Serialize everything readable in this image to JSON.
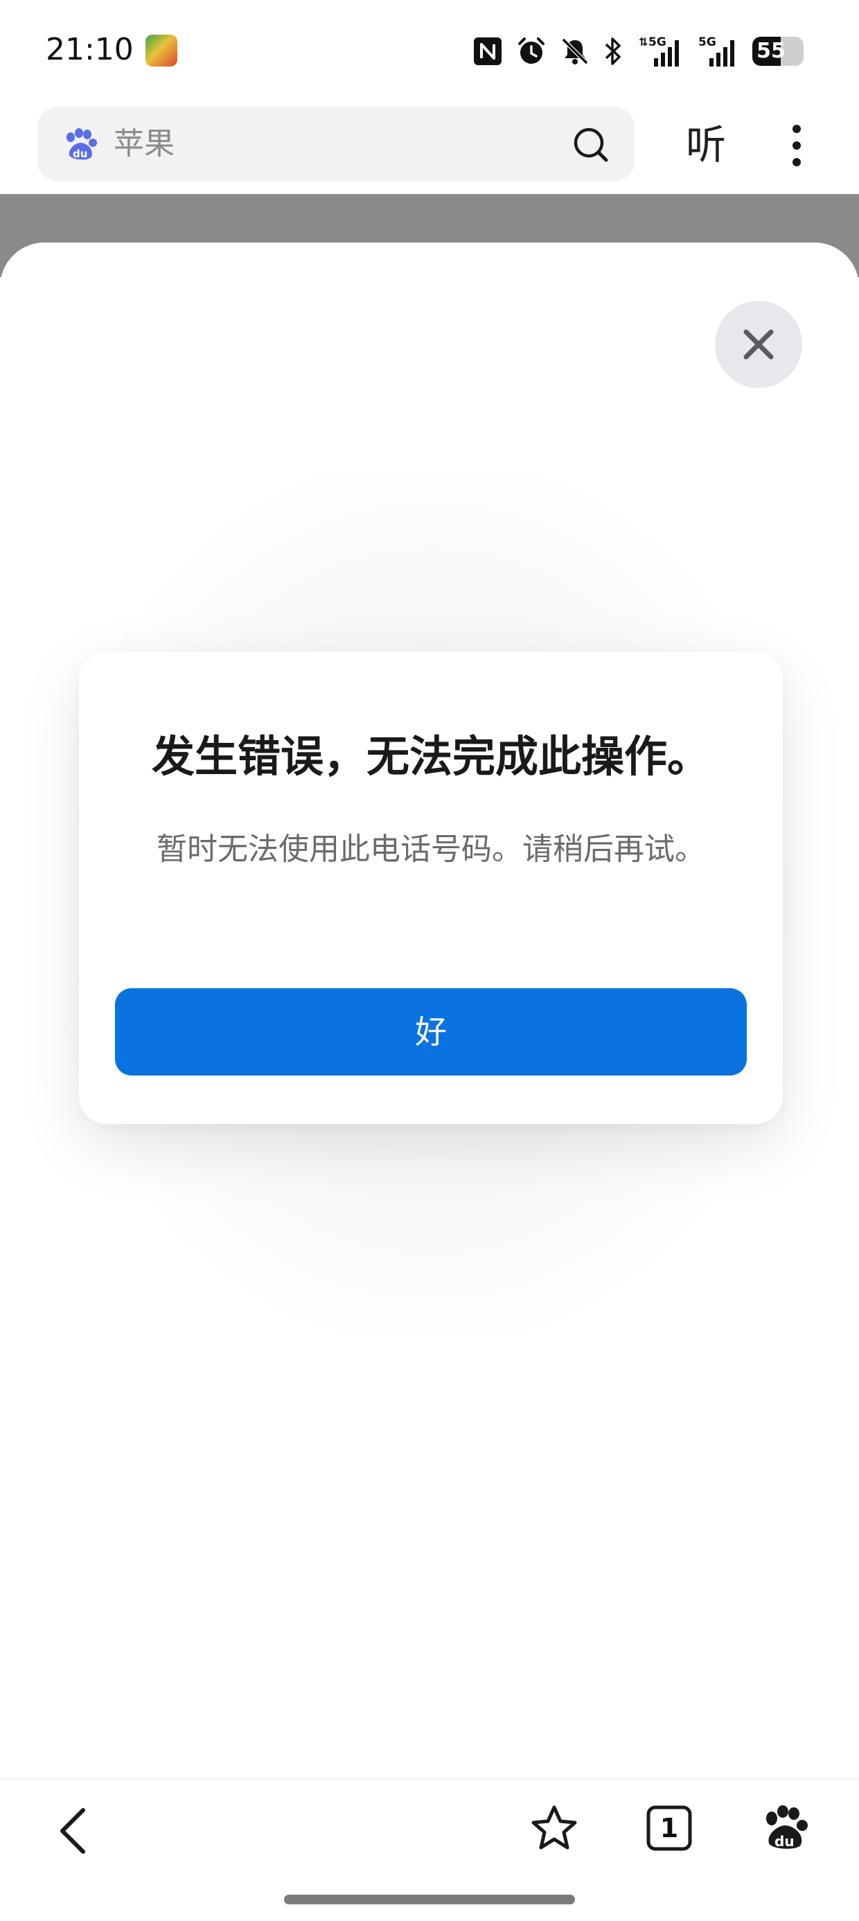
{
  "status_bar": {
    "time": "21:10",
    "battery": "55",
    "battery_fraction": 0.55,
    "signal_1": "5G",
    "signal_2": "5G"
  },
  "search": {
    "query": "苹果"
  },
  "header": {
    "listen_label": "听"
  },
  "dialog": {
    "title": "发生错误，无法完成此操作。",
    "message": "暂时无法使用此电话号码。请稍后再试。",
    "ok_label": "好"
  },
  "bottom_nav": {
    "tab_count": "1"
  },
  "colors": {
    "accent": "#0a73e0",
    "backdrop": "#8a8a8a"
  }
}
